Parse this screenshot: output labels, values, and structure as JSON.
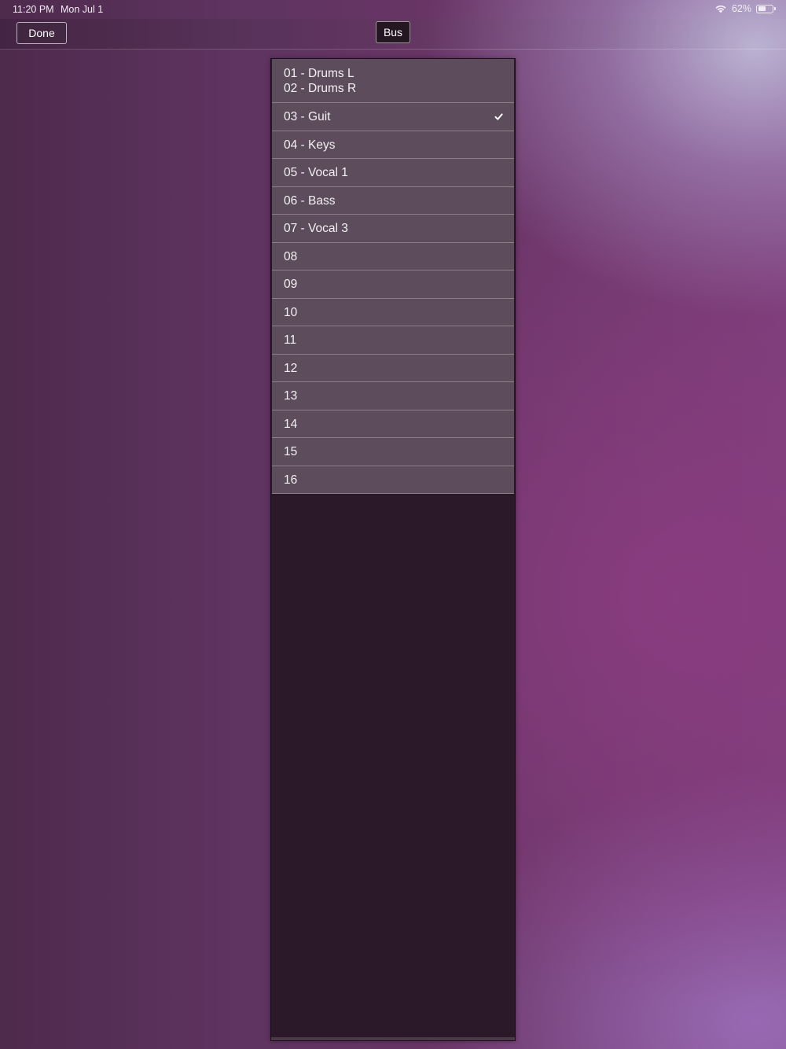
{
  "status_bar": {
    "time": "11:20 PM",
    "date": "Mon Jul 1",
    "battery_percent_label": "62%",
    "battery_level": 0.62
  },
  "toolbar": {
    "done_label": "Done",
    "bus_label": "Bus"
  },
  "list": {
    "first_item": {
      "line1": "01 - Drums L",
      "line2": "02 - Drums R"
    },
    "items": [
      {
        "label": "03 - Guit",
        "selected": true
      },
      {
        "label": "04 - Keys",
        "selected": false
      },
      {
        "label": "05 - Vocal 1",
        "selected": false
      },
      {
        "label": "06 - Bass",
        "selected": false
      },
      {
        "label": "07 - Vocal 3",
        "selected": false
      },
      {
        "label": "08",
        "selected": false
      },
      {
        "label": "09",
        "selected": false
      },
      {
        "label": "10",
        "selected": false
      },
      {
        "label": "11",
        "selected": false
      },
      {
        "label": "12",
        "selected": false
      },
      {
        "label": "13",
        "selected": false
      },
      {
        "label": "14",
        "selected": false
      },
      {
        "label": "15",
        "selected": false
      },
      {
        "label": "16",
        "selected": false
      }
    ]
  },
  "icons": {
    "wifi": "wifi-icon",
    "battery": "battery-icon",
    "check": "checkmark-icon"
  }
}
